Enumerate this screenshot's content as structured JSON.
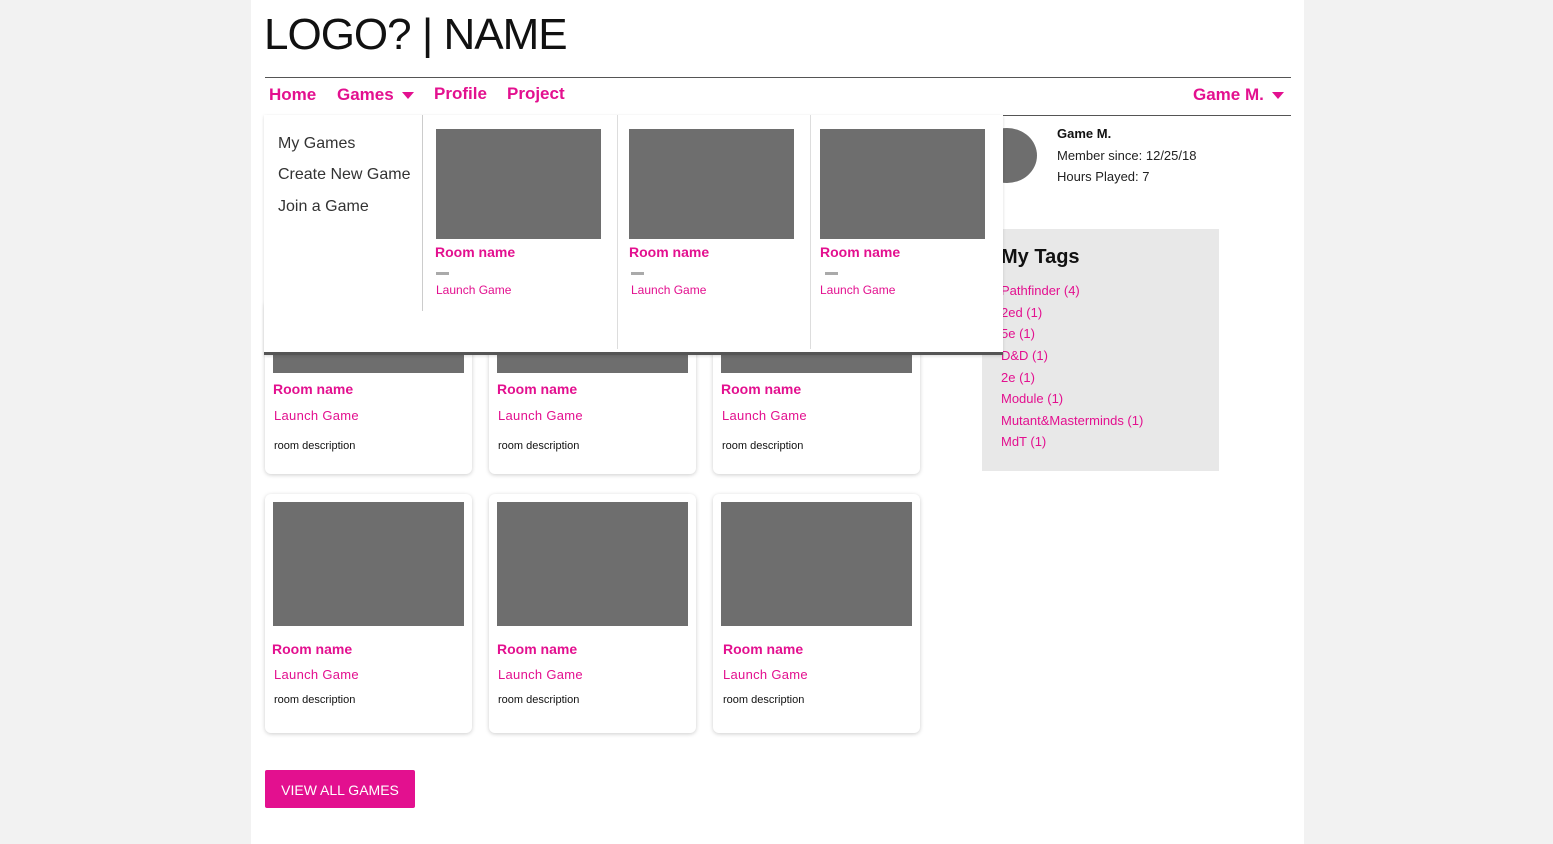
{
  "header": {
    "logo_text": "LOGO? | NAME"
  },
  "nav": {
    "home": "Home",
    "games": "Games",
    "profile": "Profile",
    "project": "Project",
    "user": "Game M."
  },
  "dropdown": {
    "menu": [
      "My Games",
      "Create New Game",
      "Join a Game"
    ],
    "rooms": [
      {
        "name": "Room name",
        "launch": "Launch Game"
      },
      {
        "name": "Room name",
        "launch": "Launch Game"
      },
      {
        "name": "Room name",
        "launch": "Launch Game"
      }
    ]
  },
  "profile": {
    "name": "Game M.",
    "member_since": "Member since: 12/25/18",
    "hours_played": "Hours Played: 7"
  },
  "tags": {
    "title": "My Tags",
    "items": [
      "Pathfinder (4)",
      "2ed (1)",
      "5e (1)",
      "D&D (1)",
      "2e (1)",
      "Module (1)",
      "Mutant&Masterminds (1)",
      "MdT (1)"
    ]
  },
  "cards": [
    {
      "name": "Room name",
      "launch": "Launch Game",
      "desc": "room description"
    },
    {
      "name": "Room name",
      "launch": "Launch Game",
      "desc": "room description"
    },
    {
      "name": "Room name",
      "launch": "Launch Game",
      "desc": "room description"
    },
    {
      "name": "Room name",
      "launch": "Launch Game",
      "desc": "room description"
    },
    {
      "name": "Room name",
      "launch": "Launch Game",
      "desc": "room description"
    },
    {
      "name": "Room name",
      "launch": "Launch Game",
      "desc": "room description"
    }
  ],
  "view_all_label": "VIEW ALL GAMES",
  "colors": {
    "accent": "#e3108f",
    "placeholder": "#6e6e6e",
    "tags_bg": "#e8e8e8"
  }
}
